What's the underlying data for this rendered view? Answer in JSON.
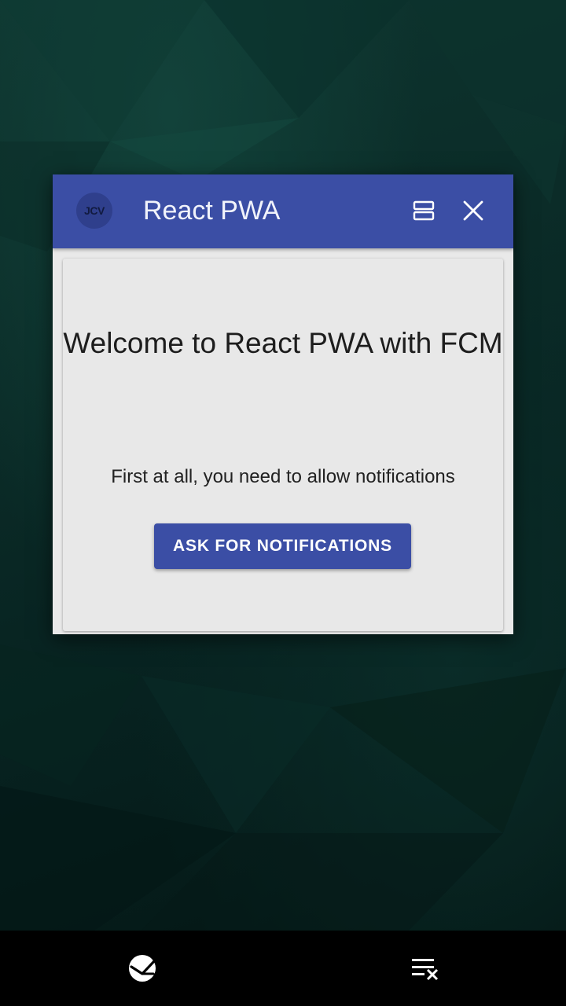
{
  "app": {
    "avatar_text": "JCV",
    "title": "React PWA",
    "header_color": "#3b4ea5"
  },
  "header_icons": {
    "split_screen": "split-screen-icon",
    "close": "close-icon"
  },
  "content": {
    "welcome_title": "Welcome to React PWA with FCM",
    "intro_text": "First at all, you need to allow notifications",
    "ask_button_label": "ASK FOR NOTIFICATIONS",
    "accent_color": "#3b4ea5"
  },
  "nav_bar": {
    "left_icon": "smart-manager-icon",
    "right_icon": "clear-all-icon"
  }
}
